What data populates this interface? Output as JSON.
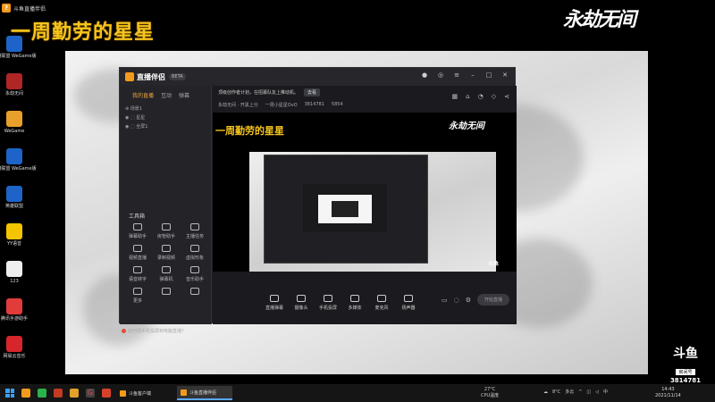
{
  "stream": {
    "app_label": "斗鱼直播伴侣",
    "banner_title": "一周勤劳的星星",
    "game_logo": "永劫无间"
  },
  "desktop_icons": [
    {
      "label": "英雄联盟\nWeGame版",
      "color": "#1e64c8"
    },
    {
      "label": "永劫无间",
      "color": "#b02626"
    },
    {
      "label": "WeGame",
      "color": "#e8a02a"
    },
    {
      "label": "英雄联盟\nWeGame版",
      "color": "#1e64c8"
    },
    {
      "label": "英雄联盟",
      "color": "#1e64c8"
    },
    {
      "label": "YY语音",
      "color": "#f5c400"
    },
    {
      "label": "123",
      "color": "#eeeeee"
    },
    {
      "label": "腾讯手游助手",
      "color": "#e23b3b"
    },
    {
      "label": "网易云音乐",
      "color": "#d6262b"
    }
  ],
  "app": {
    "name": "直播伴侣",
    "version": "BETA",
    "left_tabs": [
      "我的直播",
      "互动",
      "弹幕"
    ],
    "scenes": [
      "场景1",
      "星星",
      "全屏1"
    ],
    "tools_label": "工具箱",
    "tools": [
      "弹幕助手",
      "房管助手",
      "主播任务",
      "视频直播",
      "录制视频",
      "虚拟形象",
      "语音转字",
      "弹幕机",
      "音乐助手",
      "更多",
      "",
      ""
    ],
    "bottom_tip": "如何把手机投屏到电脑直播?",
    "notice": "顶级创作者计划，在招募队友上推动机。",
    "notice_button": "去看",
    "info": [
      "永劫无间 · 开黑上分",
      "一周小星星OvO",
      "3814781",
      "5854"
    ],
    "bottom_items": [
      "直播弹幕",
      "摄像头",
      "手机投屏",
      "多媒体",
      "麦克风",
      "扬声器"
    ],
    "go_live": "开始直播"
  },
  "watermark": {
    "brand": "斗鱼",
    "room_label": "房间号",
    "room_number": "3814781"
  },
  "taskbar": {
    "tasks": [
      "斗鱼客户端",
      "斗鱼直播伴侣"
    ],
    "weather_temp": "27°C",
    "weather_label": "CPU温度",
    "tray_temp": "8°C",
    "tray_weather": "多云",
    "time": "14:43",
    "date": "2021/11/14"
  }
}
